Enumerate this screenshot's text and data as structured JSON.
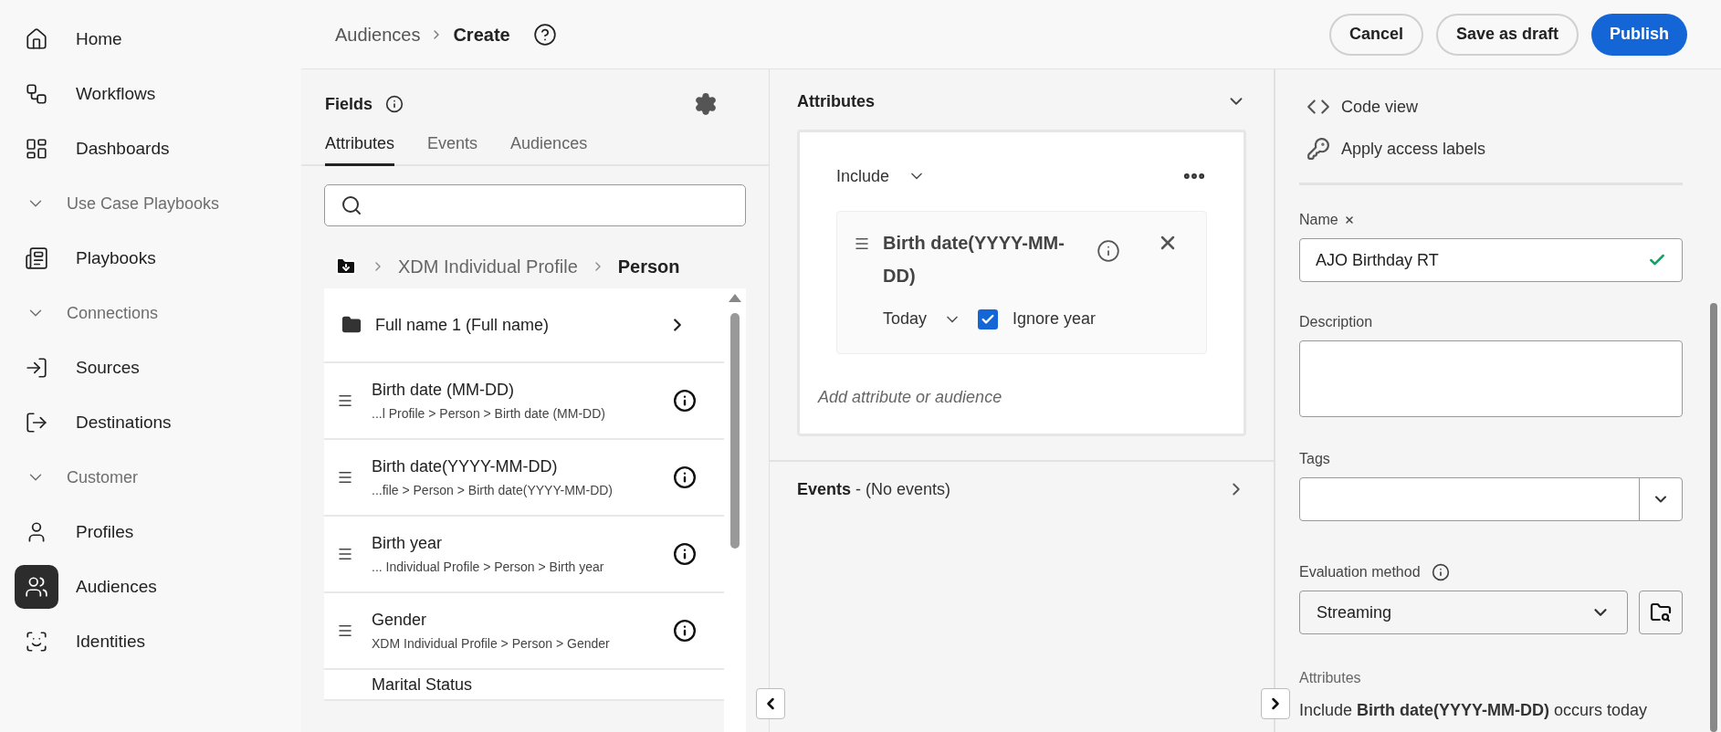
{
  "sidebar": {
    "items": [
      {
        "kind": "link",
        "label": "Home",
        "selected": false
      },
      {
        "kind": "link",
        "label": "Workflows",
        "selected": false
      },
      {
        "kind": "link",
        "label": "Dashboards",
        "selected": false
      },
      {
        "kind": "section",
        "label": "Use Case Playbooks"
      },
      {
        "kind": "link",
        "label": "Playbooks",
        "selected": false
      },
      {
        "kind": "section",
        "label": "Connections"
      },
      {
        "kind": "link",
        "label": "Sources",
        "selected": false
      },
      {
        "kind": "link",
        "label": "Destinations",
        "selected": false
      },
      {
        "kind": "section",
        "label": "Customer"
      },
      {
        "kind": "link",
        "label": "Profiles",
        "selected": false
      },
      {
        "kind": "link",
        "label": "Audiences",
        "selected": true
      },
      {
        "kind": "link",
        "label": "Identities",
        "selected": false
      }
    ]
  },
  "header": {
    "breadcrumb": [
      "Audiences",
      "Create"
    ],
    "buttons": [
      {
        "label": "Cancel",
        "kind": "secondary"
      },
      {
        "label": "Save as draft",
        "kind": "secondary"
      },
      {
        "label": "Publish",
        "kind": "primary"
      }
    ]
  },
  "fields": {
    "title": "Fields",
    "tabs": [
      {
        "label": "Attributes",
        "selected": true
      },
      {
        "label": "Events",
        "selected": false
      },
      {
        "label": "Audiences",
        "selected": false
      }
    ],
    "path": [
      "XDM Individual Profile",
      "Person"
    ],
    "items": [
      {
        "kind": "folder",
        "label": "Full name 1 (Full name)"
      },
      {
        "kind": "field",
        "label": "Birth date (MM-DD)",
        "path": "...l Profile > Person > Birth date (MM-DD)"
      },
      {
        "kind": "field",
        "label": "Birth date(YYYY-MM-DD)",
        "path": "...file > Person > Birth date(YYYY-MM-DD)"
      },
      {
        "kind": "field",
        "label": "Birth year",
        "path": "... Individual Profile > Person > Birth year"
      },
      {
        "kind": "field",
        "label": "Gender",
        "path": "XDM Individual Profile > Person > Gender"
      },
      {
        "kind": "field",
        "label": "Marital Status"
      }
    ]
  },
  "builder": {
    "attributes_title": "Attributes",
    "operator": "Include",
    "condition": {
      "label": "Birth date(YYYY-MM-DD)",
      "when": "Today",
      "ignore_year": {
        "label": "Ignore year",
        "checked": true
      }
    },
    "add_placeholder": "Add attribute or audience",
    "events_title": "Events",
    "events_note": "- (No events)"
  },
  "properties": {
    "actions": [
      {
        "label": "Code view"
      },
      {
        "label": "Apply access labels"
      }
    ],
    "name": {
      "label": "Name",
      "required": true,
      "value": "AJO Birthday RT",
      "valid": true
    },
    "description": {
      "label": "Description"
    },
    "tags": {
      "label": "Tags"
    },
    "evaluation": {
      "label": "Evaluation method",
      "value": "Streaming"
    },
    "summary": {
      "label": "Attributes",
      "text": "Include **Birth date(YYYY-MM-DD)** occurs today"
    }
  }
}
